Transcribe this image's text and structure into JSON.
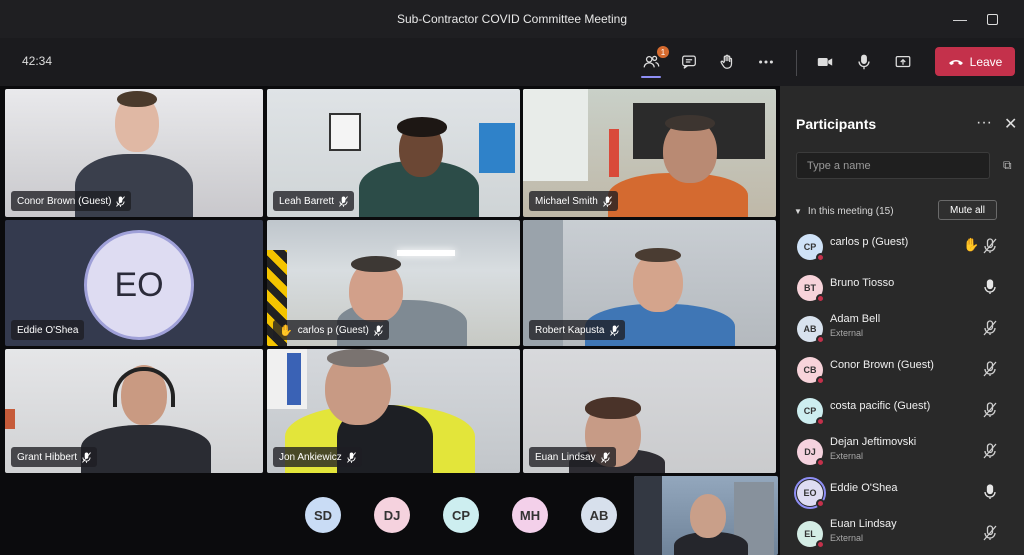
{
  "window": {
    "title": "Sub-Contractor COVID Committee Meeting",
    "minimize": "—"
  },
  "toolbar": {
    "timer": "42:34",
    "participants_badge": "1",
    "leave_label": "Leave",
    "icons": [
      "participants-icon",
      "chat-icon",
      "raise-hand-icon",
      "more-icon",
      "camera-icon",
      "mic-icon",
      "share-icon"
    ]
  },
  "tiles": [
    {
      "name": "Conor Brown (Guest)"
    },
    {
      "name": "Leah Barrett"
    },
    {
      "name": "Michael Smith"
    },
    {
      "name": "Eddie O'Shea",
      "initials": "EO"
    },
    {
      "name": "carlos p (Guest)"
    },
    {
      "name": "Robert Kapusta"
    },
    {
      "name": "Grant Hibbert"
    },
    {
      "name": "Jon Ankiewicz"
    },
    {
      "name": "Euan Lindsay"
    }
  ],
  "overflow_avatars": [
    {
      "initials": "SD",
      "color": "#c9dcf5"
    },
    {
      "initials": "DJ",
      "color": "#f5d2de"
    },
    {
      "initials": "CP",
      "color": "#cdeef0"
    },
    {
      "initials": "MH",
      "color": "#f3d0ea"
    },
    {
      "initials": "AB",
      "color": "#d7e0ec"
    }
  ],
  "panel": {
    "title": "Participants",
    "more": "···",
    "close": "✕",
    "search_placeholder": "Type a name",
    "section_label": "In this meeting (15)",
    "mute_all_label": "Mute all",
    "participants": [
      {
        "initials": "CP",
        "name": "carlos p (Guest)",
        "sub": "",
        "avatar_color": "#cfe2f7",
        "mic": "muted",
        "hand": true,
        "selected": false
      },
      {
        "initials": "BT",
        "name": "Bruno Tiosso",
        "sub": "",
        "avatar_color": "#f7d3da",
        "mic": "on",
        "hand": false,
        "selected": false
      },
      {
        "initials": "AB",
        "name": "Adam Bell",
        "sub": "External",
        "avatar_color": "#d8e2ee",
        "mic": "muted",
        "hand": false,
        "selected": false
      },
      {
        "initials": "CB",
        "name": "Conor Brown (Guest)",
        "sub": "",
        "avatar_color": "#f7d3da",
        "mic": "muted",
        "hand": false,
        "selected": false
      },
      {
        "initials": "CP",
        "name": "costa pacific (Guest)",
        "sub": "",
        "avatar_color": "#cdeef0",
        "mic": "muted",
        "hand": false,
        "selected": false
      },
      {
        "initials": "DJ",
        "name": "Dejan Jeftimovski",
        "sub": "External",
        "avatar_color": "#f5d2de",
        "mic": "muted",
        "hand": false,
        "selected": false
      },
      {
        "initials": "EO",
        "name": "Eddie O'Shea",
        "sub": "",
        "avatar_color": "#dedcf2",
        "mic": "on",
        "hand": false,
        "selected": true
      },
      {
        "initials": "EL",
        "name": "Euan Lindsay",
        "sub": "External",
        "avatar_color": "#d4ede5",
        "mic": "muted",
        "hand": false,
        "selected": false
      }
    ]
  },
  "colors": {
    "accent": "#8e8ef5",
    "leave": "#c4314b",
    "hand": "#f2c94c"
  }
}
